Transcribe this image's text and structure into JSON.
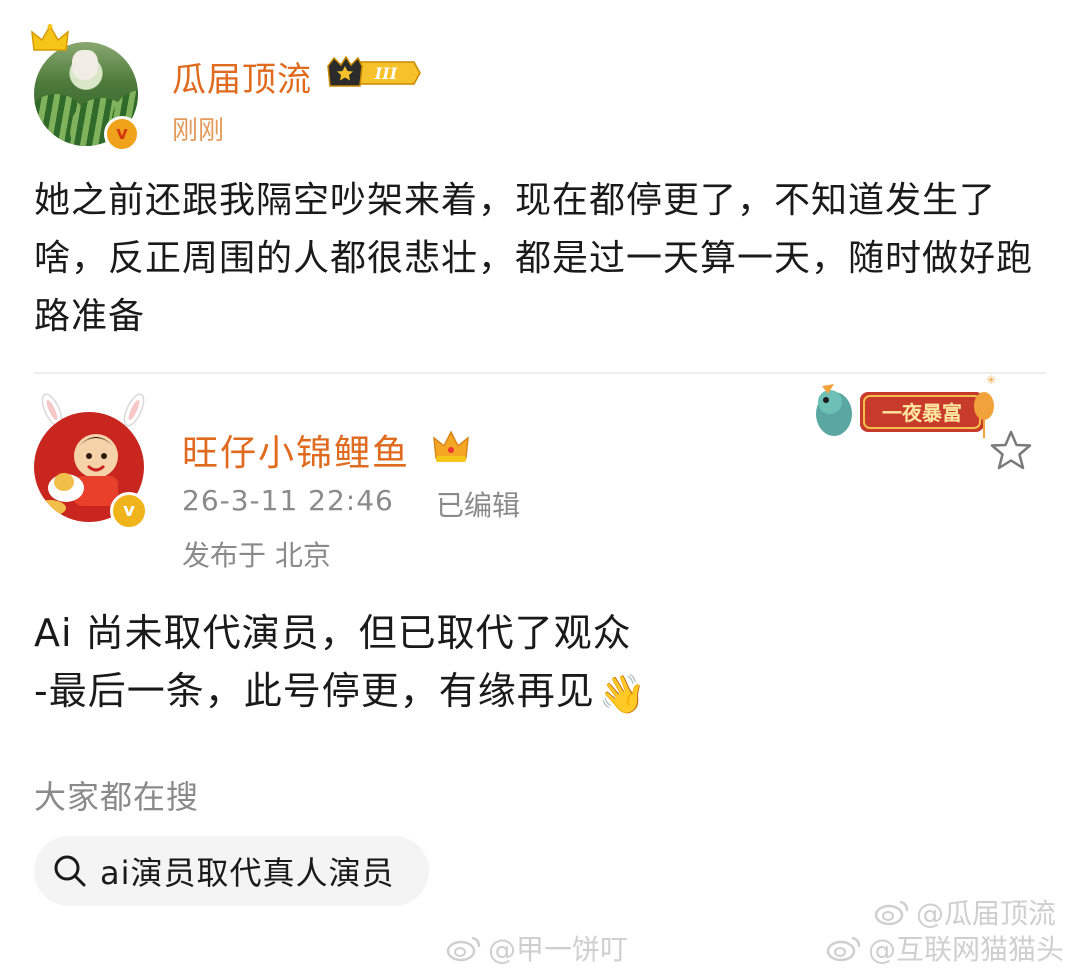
{
  "post1": {
    "username": "瓜届顶流",
    "level_badge": "III",
    "time": "刚刚",
    "verified_icon": "v-badge-icon",
    "content": "她之前还跟我隔空吵架来着，现在都停更了，不知道发生了啥，反正周围的人都很悲壮，都是过一天算一天，随时做好跑路准备"
  },
  "post2": {
    "username": "旺仔小锦鲤鱼",
    "date": "26-3-11 22:46",
    "edited": "已编辑",
    "location": "发布于 北京",
    "decor_text": "一夜暴富",
    "content_line1": "Ai 尚未取代演员，但已取代了观众",
    "content_line2": "-最后一条，此号停更，有缘再见",
    "content_emoji": "👋"
  },
  "search": {
    "title": "大家都在搜",
    "query": "ai演员取代真人演员"
  },
  "watermarks": {
    "wm1": "@瓜届顶流",
    "wm2": "@甲一饼叮",
    "wm3": "@互联网猫猫头"
  },
  "colors": {
    "username": "#e06a1e",
    "time_orange": "#e39a5a",
    "meta_gray": "#8a8a8a",
    "chip_bg": "#f4f4f4"
  }
}
